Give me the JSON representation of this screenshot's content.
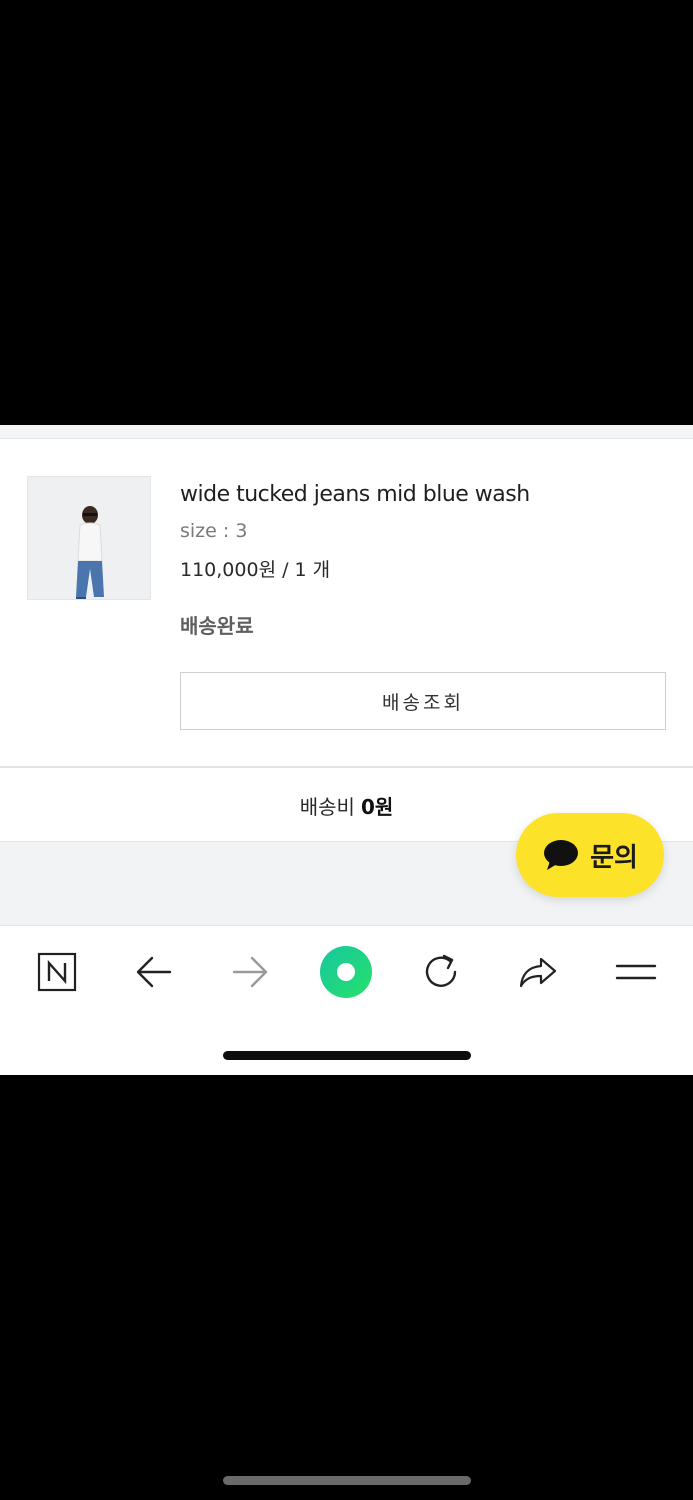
{
  "order_item": {
    "product_name": "wide tucked jeans mid blue wash",
    "option": "size : 3",
    "price_qty": "110,000원 / 1 개",
    "status": "배송완료",
    "track_button_label": "배송조회"
  },
  "shipping": {
    "label": "배송비",
    "amount": "0원"
  },
  "inquiry_button": {
    "label": "문의",
    "color": "#fde22a"
  },
  "browser_toolbar": {
    "items": [
      {
        "icon": "naver-n-icon",
        "label": "N"
      },
      {
        "icon": "back-arrow-icon"
      },
      {
        "icon": "forward-arrow-icon"
      },
      {
        "icon": "green-home-dot-icon",
        "color": "#19d37f"
      },
      {
        "icon": "refresh-icon"
      },
      {
        "icon": "share-icon"
      },
      {
        "icon": "menu-icon"
      }
    ]
  }
}
